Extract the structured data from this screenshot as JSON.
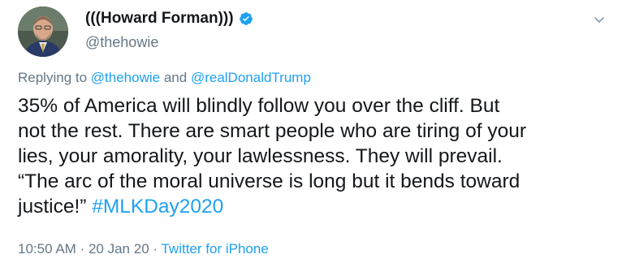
{
  "author": {
    "display_name": "(((Howard Forman)))",
    "handle": "@thehowie",
    "verified": true
  },
  "reply": {
    "prefix": "Replying to",
    "mention_1": "@thehowie",
    "conjunction": "and",
    "mention_2": "@realDonaldTrump"
  },
  "tweet": {
    "lines": [
      "35% of America will blindly follow you over the cliff. But",
      "not the rest.  There are smart people who are tiring of your",
      "lies, your amorality, your lawlessness. They will prevail.",
      "“The arc of the moral universe is long but it bends toward"
    ],
    "last_line_text": "justice!” ",
    "hashtag": "#MLKDay2020"
  },
  "meta": {
    "time": "10:50 AM",
    "separator": "·",
    "date": "20 Jan 20",
    "source": "Twitter for iPhone"
  },
  "colors": {
    "link": "#1da1f2",
    "secondary_text": "#657786",
    "primary_text": "#14171a",
    "verified_badge": "#1da1f2"
  },
  "icons": {
    "verified": "verified-badge-icon",
    "menu": "chevron-down-icon"
  }
}
